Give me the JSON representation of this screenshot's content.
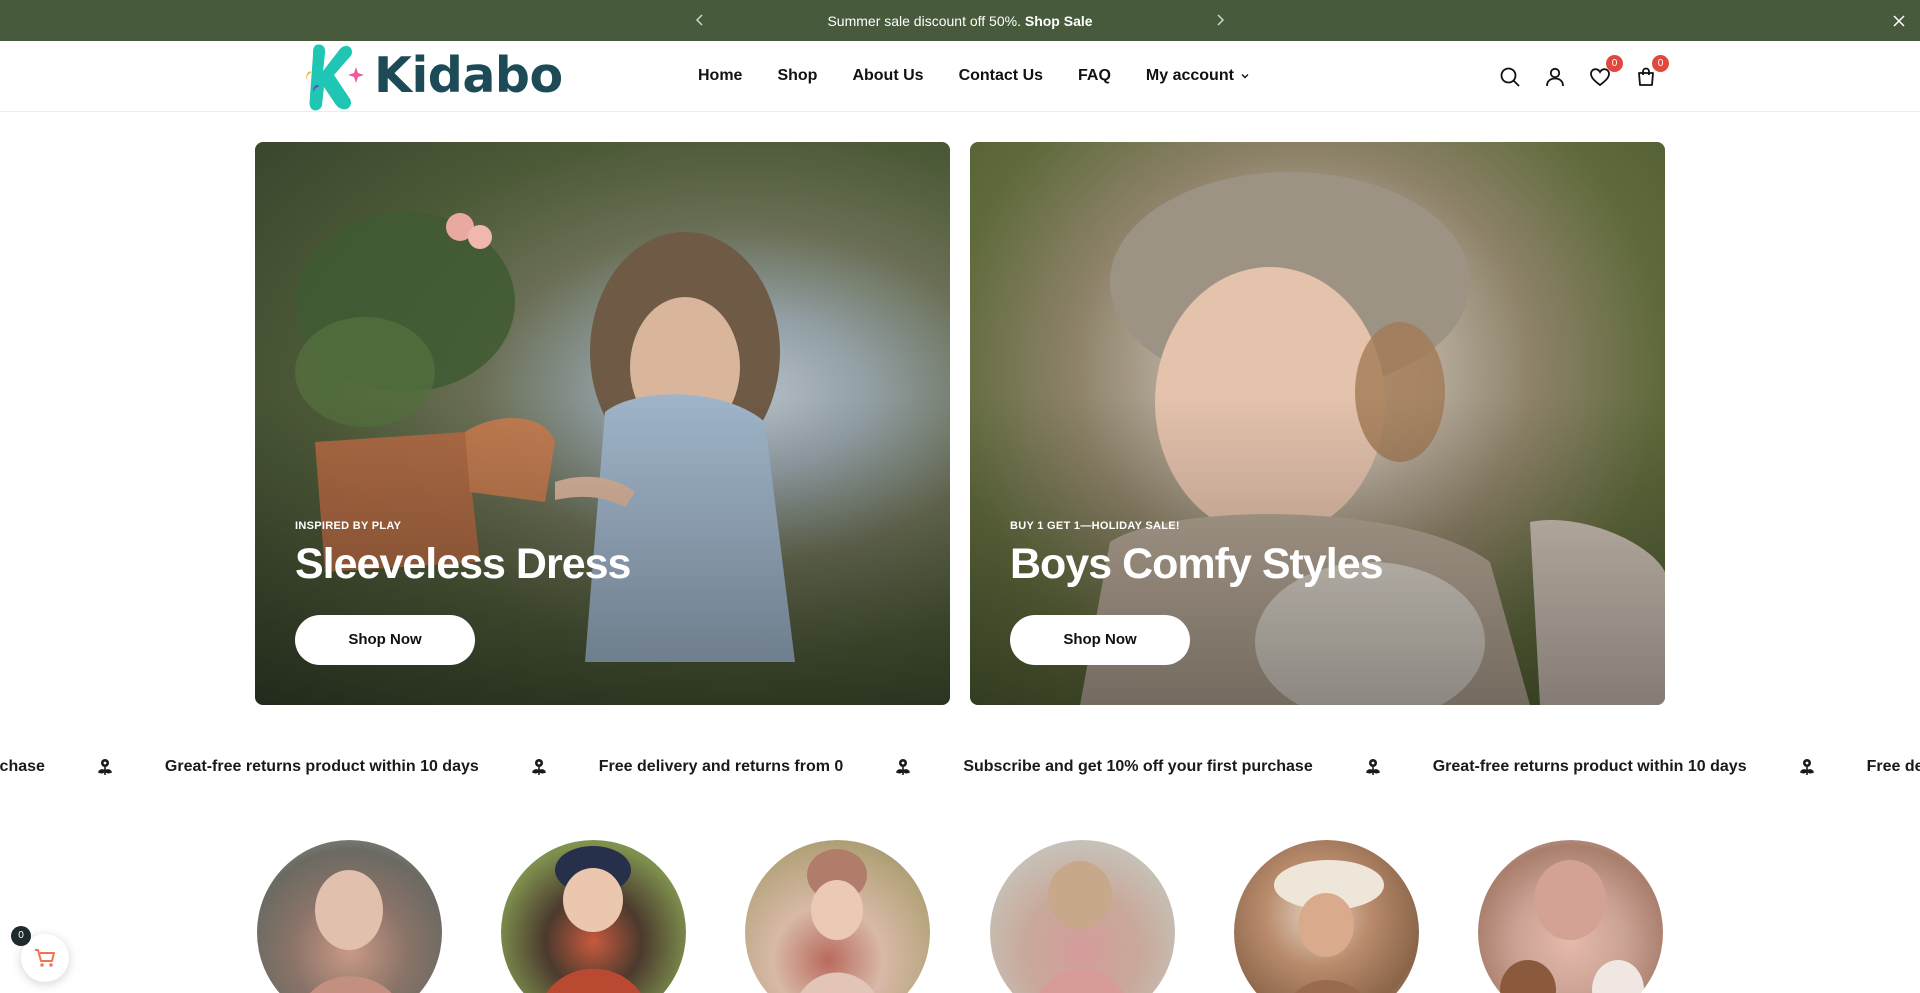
{
  "announcement": {
    "text": "Summer sale discount off 50%.",
    "link": "Shop Sale"
  },
  "brand": {
    "name": "Kidabo"
  },
  "nav": {
    "items": [
      {
        "label": "Home"
      },
      {
        "label": "Shop"
      },
      {
        "label": "About Us"
      },
      {
        "label": "Contact Us"
      },
      {
        "label": "FAQ"
      },
      {
        "label": "My account"
      }
    ]
  },
  "header_icons": {
    "wishlist_count": "0",
    "cart_count": "0"
  },
  "banners": [
    {
      "eyebrow": "INSPIRED BY PLAY",
      "title": "Sleeveless Dress",
      "button": "Shop Now"
    },
    {
      "eyebrow": "BUY 1 GET 1—HOLIDAY SALE!",
      "title": "Boys Comfy Styles",
      "button": "Shop Now"
    }
  ],
  "marquee": {
    "items": [
      "t purchase",
      "Great-free returns product within 10 days",
      "Free delivery and returns from 0",
      "Subscribe and get 10% off your first purchase",
      "Great-free returns product within 10 days",
      "Free delivery and re"
    ]
  },
  "floating_cart": {
    "count": "0"
  },
  "colors": {
    "announcement_bg": "#475a3c",
    "logo_text": "#1c4a57",
    "logo_mark": "#1fc6b3",
    "badge": "#e0483f",
    "float_cart_icon": "#f0734f"
  }
}
